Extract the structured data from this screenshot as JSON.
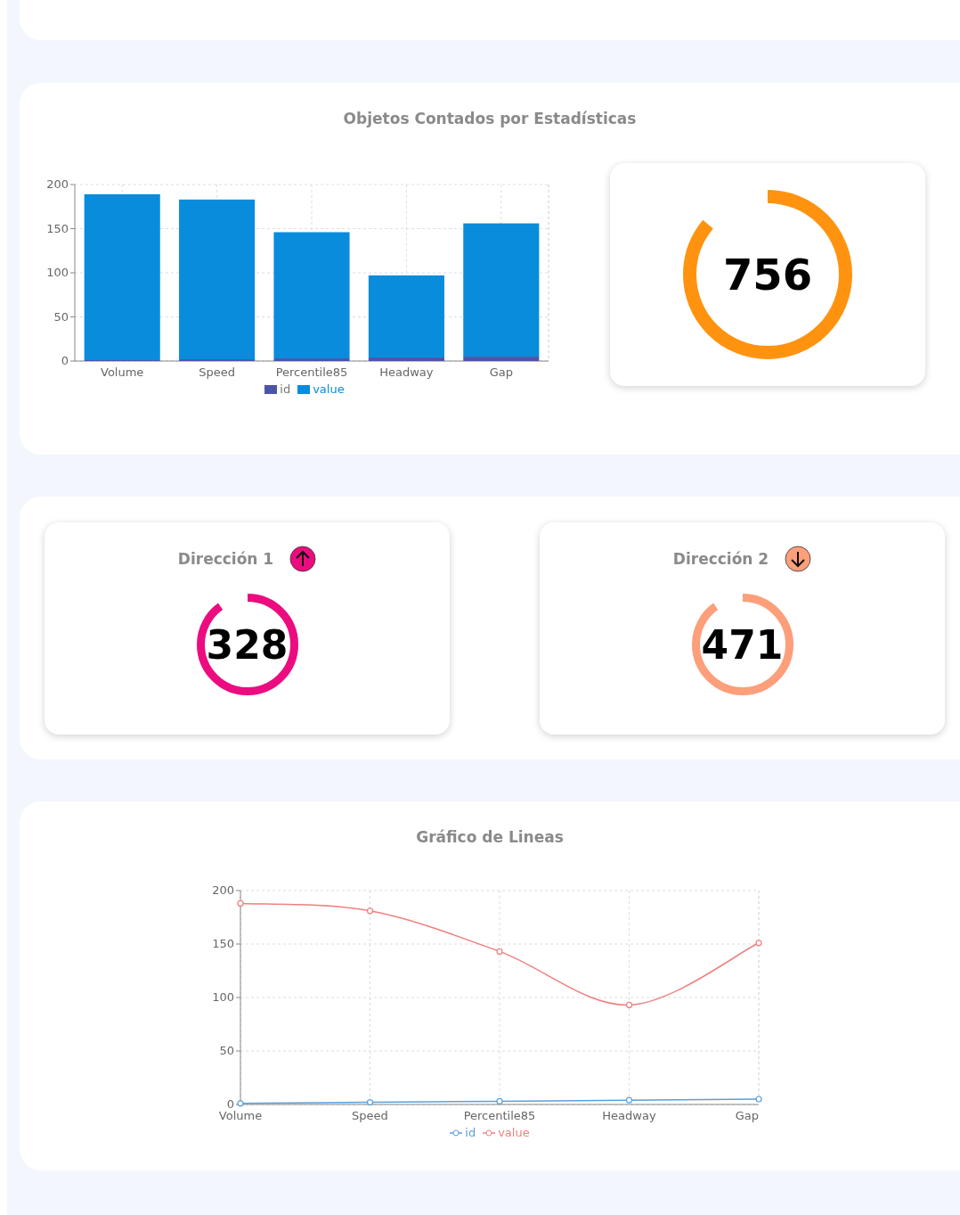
{
  "stats_card": {
    "title": "Objetos Contados por Estadísticas",
    "chart_data": {
      "type": "bar",
      "categories": [
        "Volume",
        "Speed",
        "Percentile85",
        "Headway",
        "Gap"
      ],
      "stacked": true,
      "grid": true,
      "ylim": [
        0,
        200
      ],
      "yticks": [
        0,
        50,
        100,
        150,
        200
      ],
      "series": [
        {
          "name": "id",
          "color": "#4b55a8",
          "values": [
            1,
            2,
            3,
            4,
            5
          ]
        },
        {
          "name": "value",
          "color": "#0a8cdc",
          "values": [
            188,
            181,
            143,
            93,
            151
          ]
        }
      ]
    },
    "total": {
      "value": "756",
      "level": 0.86,
      "color": "#ff930f"
    }
  },
  "directions": [
    {
      "title": "Dirección 1",
      "kind": "up",
      "color": "#ec0c7f",
      "value": "328",
      "level": 0.9
    },
    {
      "title": "Dirección 2",
      "kind": "down",
      "color": "#fc9f7a",
      "value": "471",
      "level": 0.9
    }
  ],
  "line_card": {
    "title": "Gráfico de Lineas",
    "chart_data": {
      "type": "line",
      "x": [
        "Volume",
        "Speed",
        "Percentile85",
        "Headway",
        "Gap"
      ],
      "grid": true,
      "ylim": [
        0,
        200
      ],
      "yticks": [
        0,
        50,
        100,
        150,
        200
      ],
      "series": [
        {
          "name": "id",
          "color": "#5b9fd9",
          "marker": true,
          "values": [
            1,
            2,
            3,
            4,
            5
          ]
        },
        {
          "name": "value",
          "color": "#f07f7f",
          "marker": true,
          "values": [
            188,
            181,
            143,
            93,
            151
          ]
        }
      ]
    }
  }
}
